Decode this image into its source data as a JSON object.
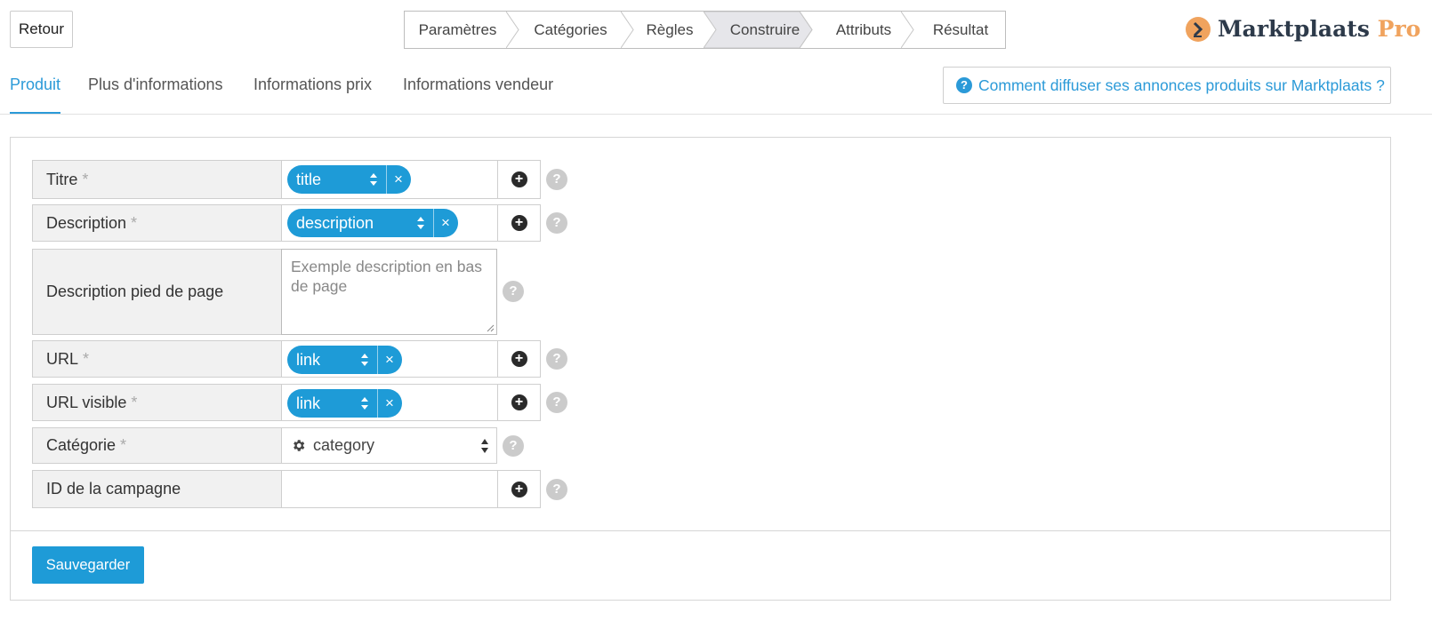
{
  "header": {
    "back_label": "Retour",
    "steps": [
      {
        "label": "Paramètres"
      },
      {
        "label": "Catégories"
      },
      {
        "label": "Règles"
      },
      {
        "label": "Construire"
      },
      {
        "label": "Attributs"
      },
      {
        "label": "Résultat"
      }
    ],
    "active_step": "Construire",
    "logo": {
      "brand": "Marktplaats",
      "suffix": "Pro"
    }
  },
  "tabs": [
    {
      "label": "Produit"
    },
    {
      "label": "Plus d'informations"
    },
    {
      "label": "Informations prix"
    },
    {
      "label": "Informations vendeur"
    }
  ],
  "active_tab": "Produit",
  "help_link": {
    "label": "Comment diffuser ses annonces produits sur Marktplaats ?",
    "icon": "question-circle-icon"
  },
  "form": {
    "required_marker": "*",
    "fields": [
      {
        "label": "Titre",
        "chip": "title"
      },
      {
        "label": "Description",
        "chip": "description"
      },
      {
        "label": "Description pied de page",
        "placeholder": "Exemple description en bas de page"
      },
      {
        "label": "URL",
        "chip": "link"
      },
      {
        "label": "URL visible",
        "chip": "link"
      },
      {
        "label": "Catégorie",
        "select": "category"
      },
      {
        "label": "ID de la campagne",
        "value": ""
      }
    ],
    "help_mark": "?",
    "add_mark": "+",
    "remove_mark": "×"
  },
  "save_label": "Sauvegarder",
  "colors": {
    "accent": "#1e9bd7",
    "logo_orange": "#f0a35e",
    "logo_dark": "#2d3a4a"
  }
}
